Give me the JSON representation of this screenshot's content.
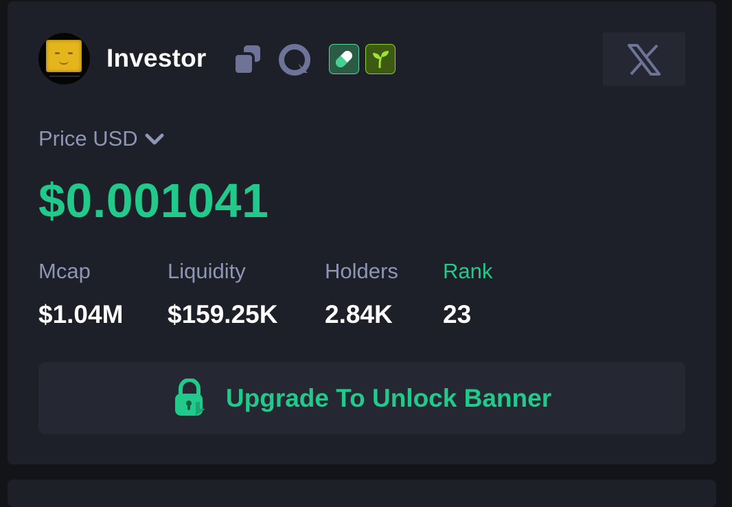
{
  "colors": {
    "card_bg": "#1d2029",
    "page_bg": "#131418",
    "accent_green": "#21c98a",
    "muted_label": "#8f95b4",
    "text_white": "#ffffff",
    "button_bg": "#252833"
  },
  "header": {
    "token_name": "Investor",
    "icons": [
      "avatar",
      "copy-icon",
      "scan-icon",
      "pill-badge-icon",
      "sprout-badge-icon",
      "x-logo-icon"
    ]
  },
  "price": {
    "label": "Price USD",
    "value": "$0.001041"
  },
  "stats": {
    "mcap": {
      "label": "Mcap",
      "value": "$1.04M"
    },
    "liquidity": {
      "label": "Liquidity",
      "value": "$159.25K"
    },
    "holders": {
      "label": "Holders",
      "value": "2.84K"
    },
    "rank": {
      "label": "Rank",
      "value": "23"
    }
  },
  "upgrade": {
    "label": "Upgrade To Unlock Banner",
    "icon": "lock-icon"
  }
}
